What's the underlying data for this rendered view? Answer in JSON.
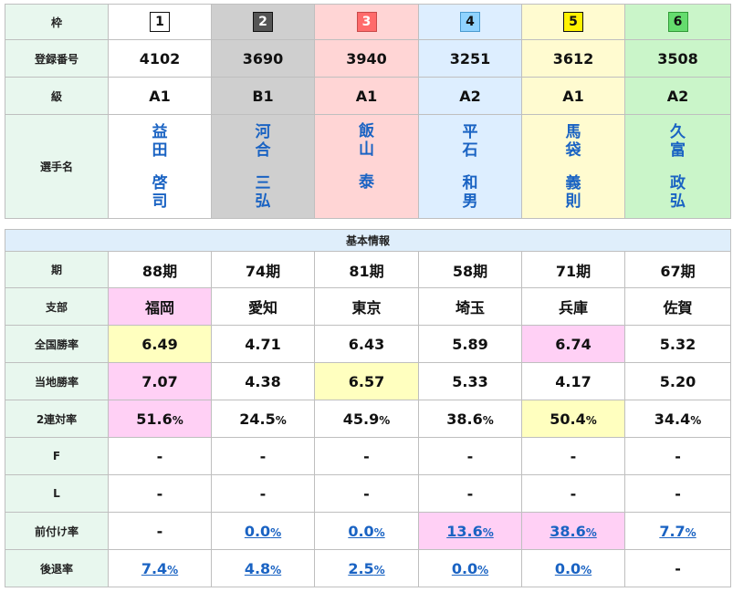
{
  "top": {
    "labels": {
      "waku": "枠",
      "reg": "登録番号",
      "class": "級",
      "name": "選手名"
    },
    "frames": [
      "1",
      "2",
      "3",
      "4",
      "5",
      "6"
    ],
    "reg_numbers": [
      "4102",
      "3690",
      "3940",
      "3251",
      "3612",
      "3508"
    ],
    "classes": [
      "A1",
      "B1",
      "A1",
      "A2",
      "A1",
      "A2"
    ],
    "racers": [
      {
        "surname": [
          "益",
          "田"
        ],
        "given": [
          "啓",
          "司"
        ]
      },
      {
        "surname": [
          "河",
          "合"
        ],
        "given": [
          "三",
          "弘"
        ]
      },
      {
        "surname": [
          "飯",
          "山"
        ],
        "given": [
          "泰"
        ]
      },
      {
        "surname": [
          "平",
          "石"
        ],
        "given": [
          "和",
          "男"
        ]
      },
      {
        "surname": [
          "馬",
          "袋"
        ],
        "given": [
          "義",
          "則"
        ]
      },
      {
        "surname": [
          "久",
          "富"
        ],
        "given": [
          "政",
          "弘"
        ]
      }
    ]
  },
  "basic": {
    "section_title": "基本情報",
    "labels": {
      "term": "期",
      "branch": "支部",
      "national": "全国勝率",
      "local": "当地勝率",
      "quinella": "2連対率",
      "f": "F",
      "l": "L",
      "fore": "前付け率",
      "back": "後退率"
    },
    "terms": [
      "88期",
      "74期",
      "81期",
      "58期",
      "71期",
      "67期"
    ],
    "branches": [
      "福岡",
      "愛知",
      "東京",
      "埼玉",
      "兵庫",
      "佐賀"
    ],
    "national_rate": [
      "6.49",
      "4.71",
      "6.43",
      "5.89",
      "6.74",
      "5.32"
    ],
    "local_rate": [
      "7.07",
      "4.38",
      "6.57",
      "5.33",
      "4.17",
      "5.20"
    ],
    "quinella_rate": [
      "51.6",
      "24.5",
      "45.9",
      "38.6",
      "50.4",
      "34.4"
    ],
    "percent_sign": "%",
    "f": [
      "-",
      "-",
      "-",
      "-",
      "-",
      "-"
    ],
    "l": [
      "-",
      "-",
      "-",
      "-",
      "-",
      "-"
    ],
    "fore_rate": [
      "-",
      "0.0",
      "0.0",
      "13.6",
      "38.6",
      "7.7"
    ],
    "back_rate": [
      "7.4",
      "4.8",
      "2.5",
      "0.0",
      "0.0",
      "-"
    ]
  }
}
